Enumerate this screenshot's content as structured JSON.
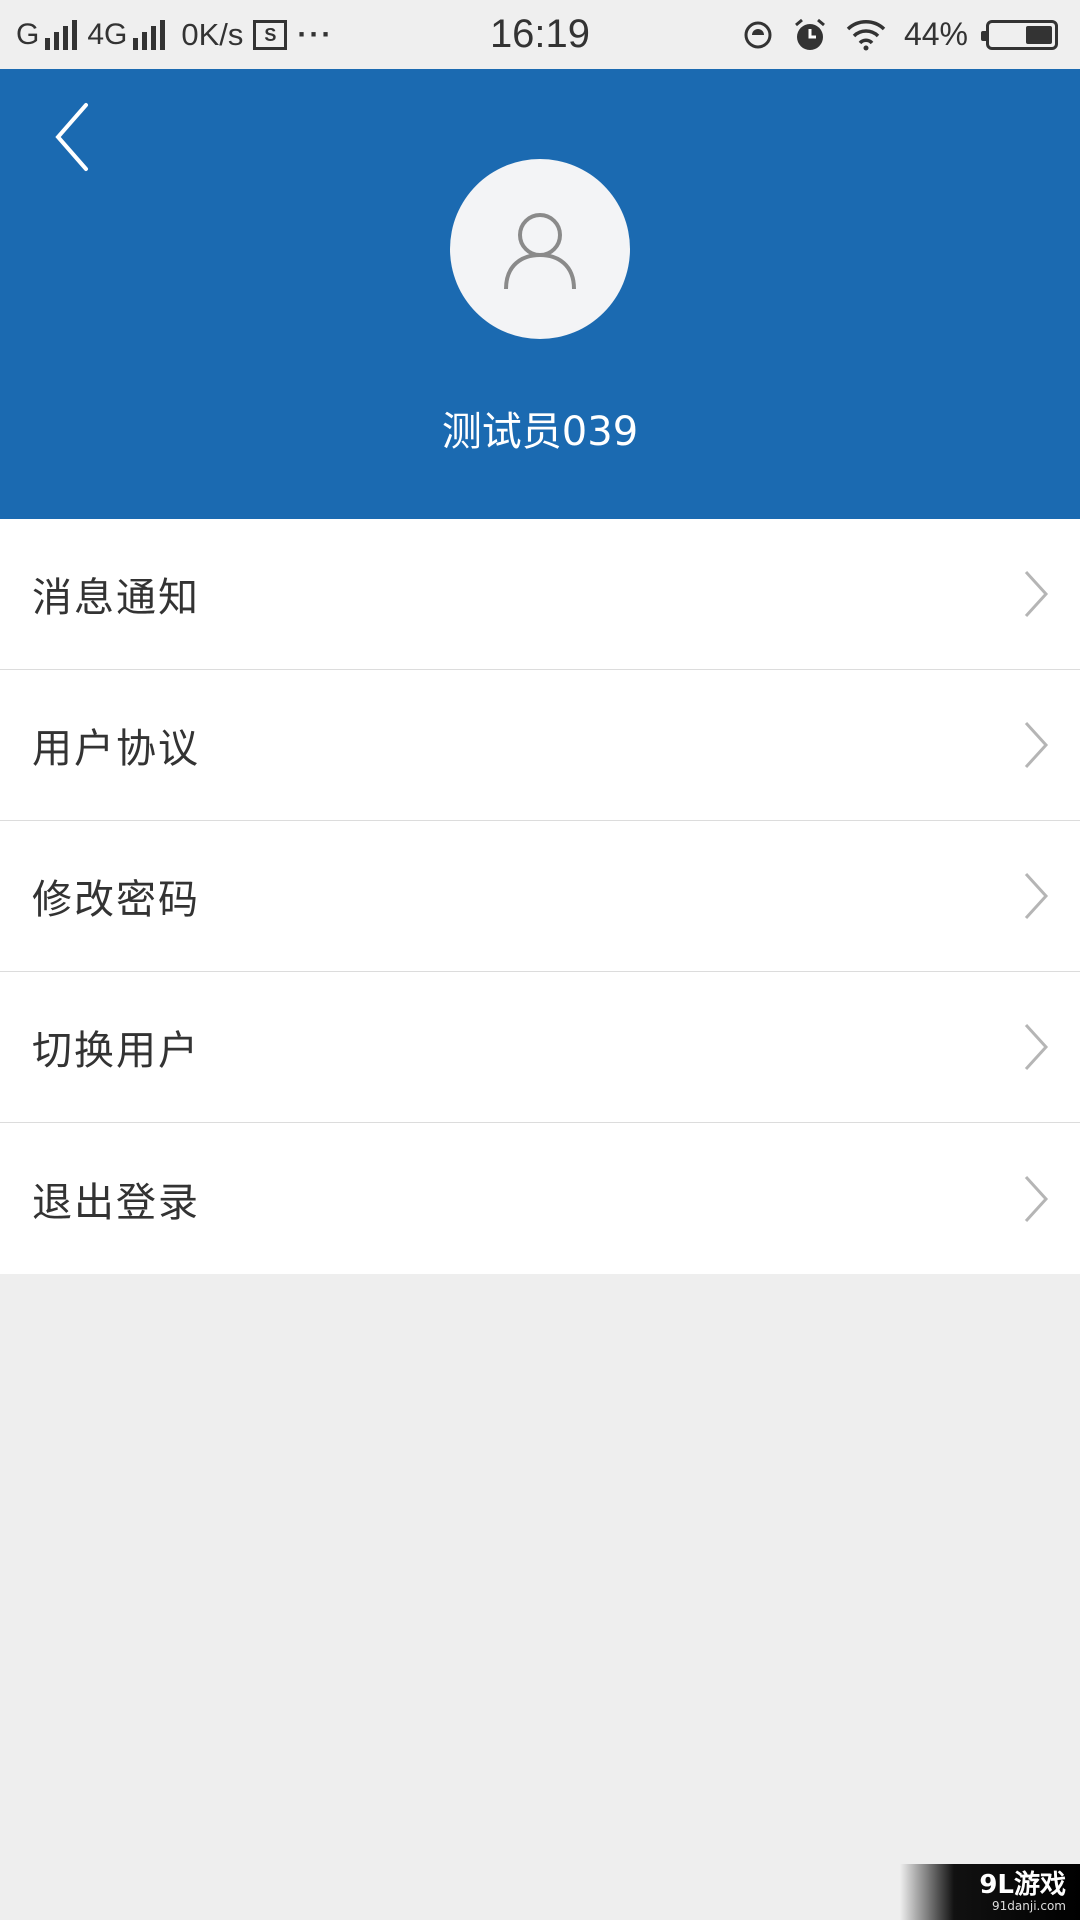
{
  "status_bar": {
    "net1": "G",
    "net2": "4G",
    "speed": "0K/s",
    "screenshot_glyph": "S",
    "dots": "···",
    "time": "16:19",
    "battery_text": "44%",
    "battery_level": 0.44
  },
  "header": {
    "username": "测试员039",
    "back_icon": "chevron-left-icon",
    "avatar_icon": "user-icon",
    "bg_color": "#1b6ab1"
  },
  "menu": {
    "items": [
      {
        "label": "消息通知"
      },
      {
        "label": "用户协议"
      },
      {
        "label": "修改密码"
      },
      {
        "label": "切换用户"
      },
      {
        "label": "退出登录"
      }
    ]
  },
  "watermark": {
    "main": "9L游戏",
    "sub": "91danji.com"
  }
}
